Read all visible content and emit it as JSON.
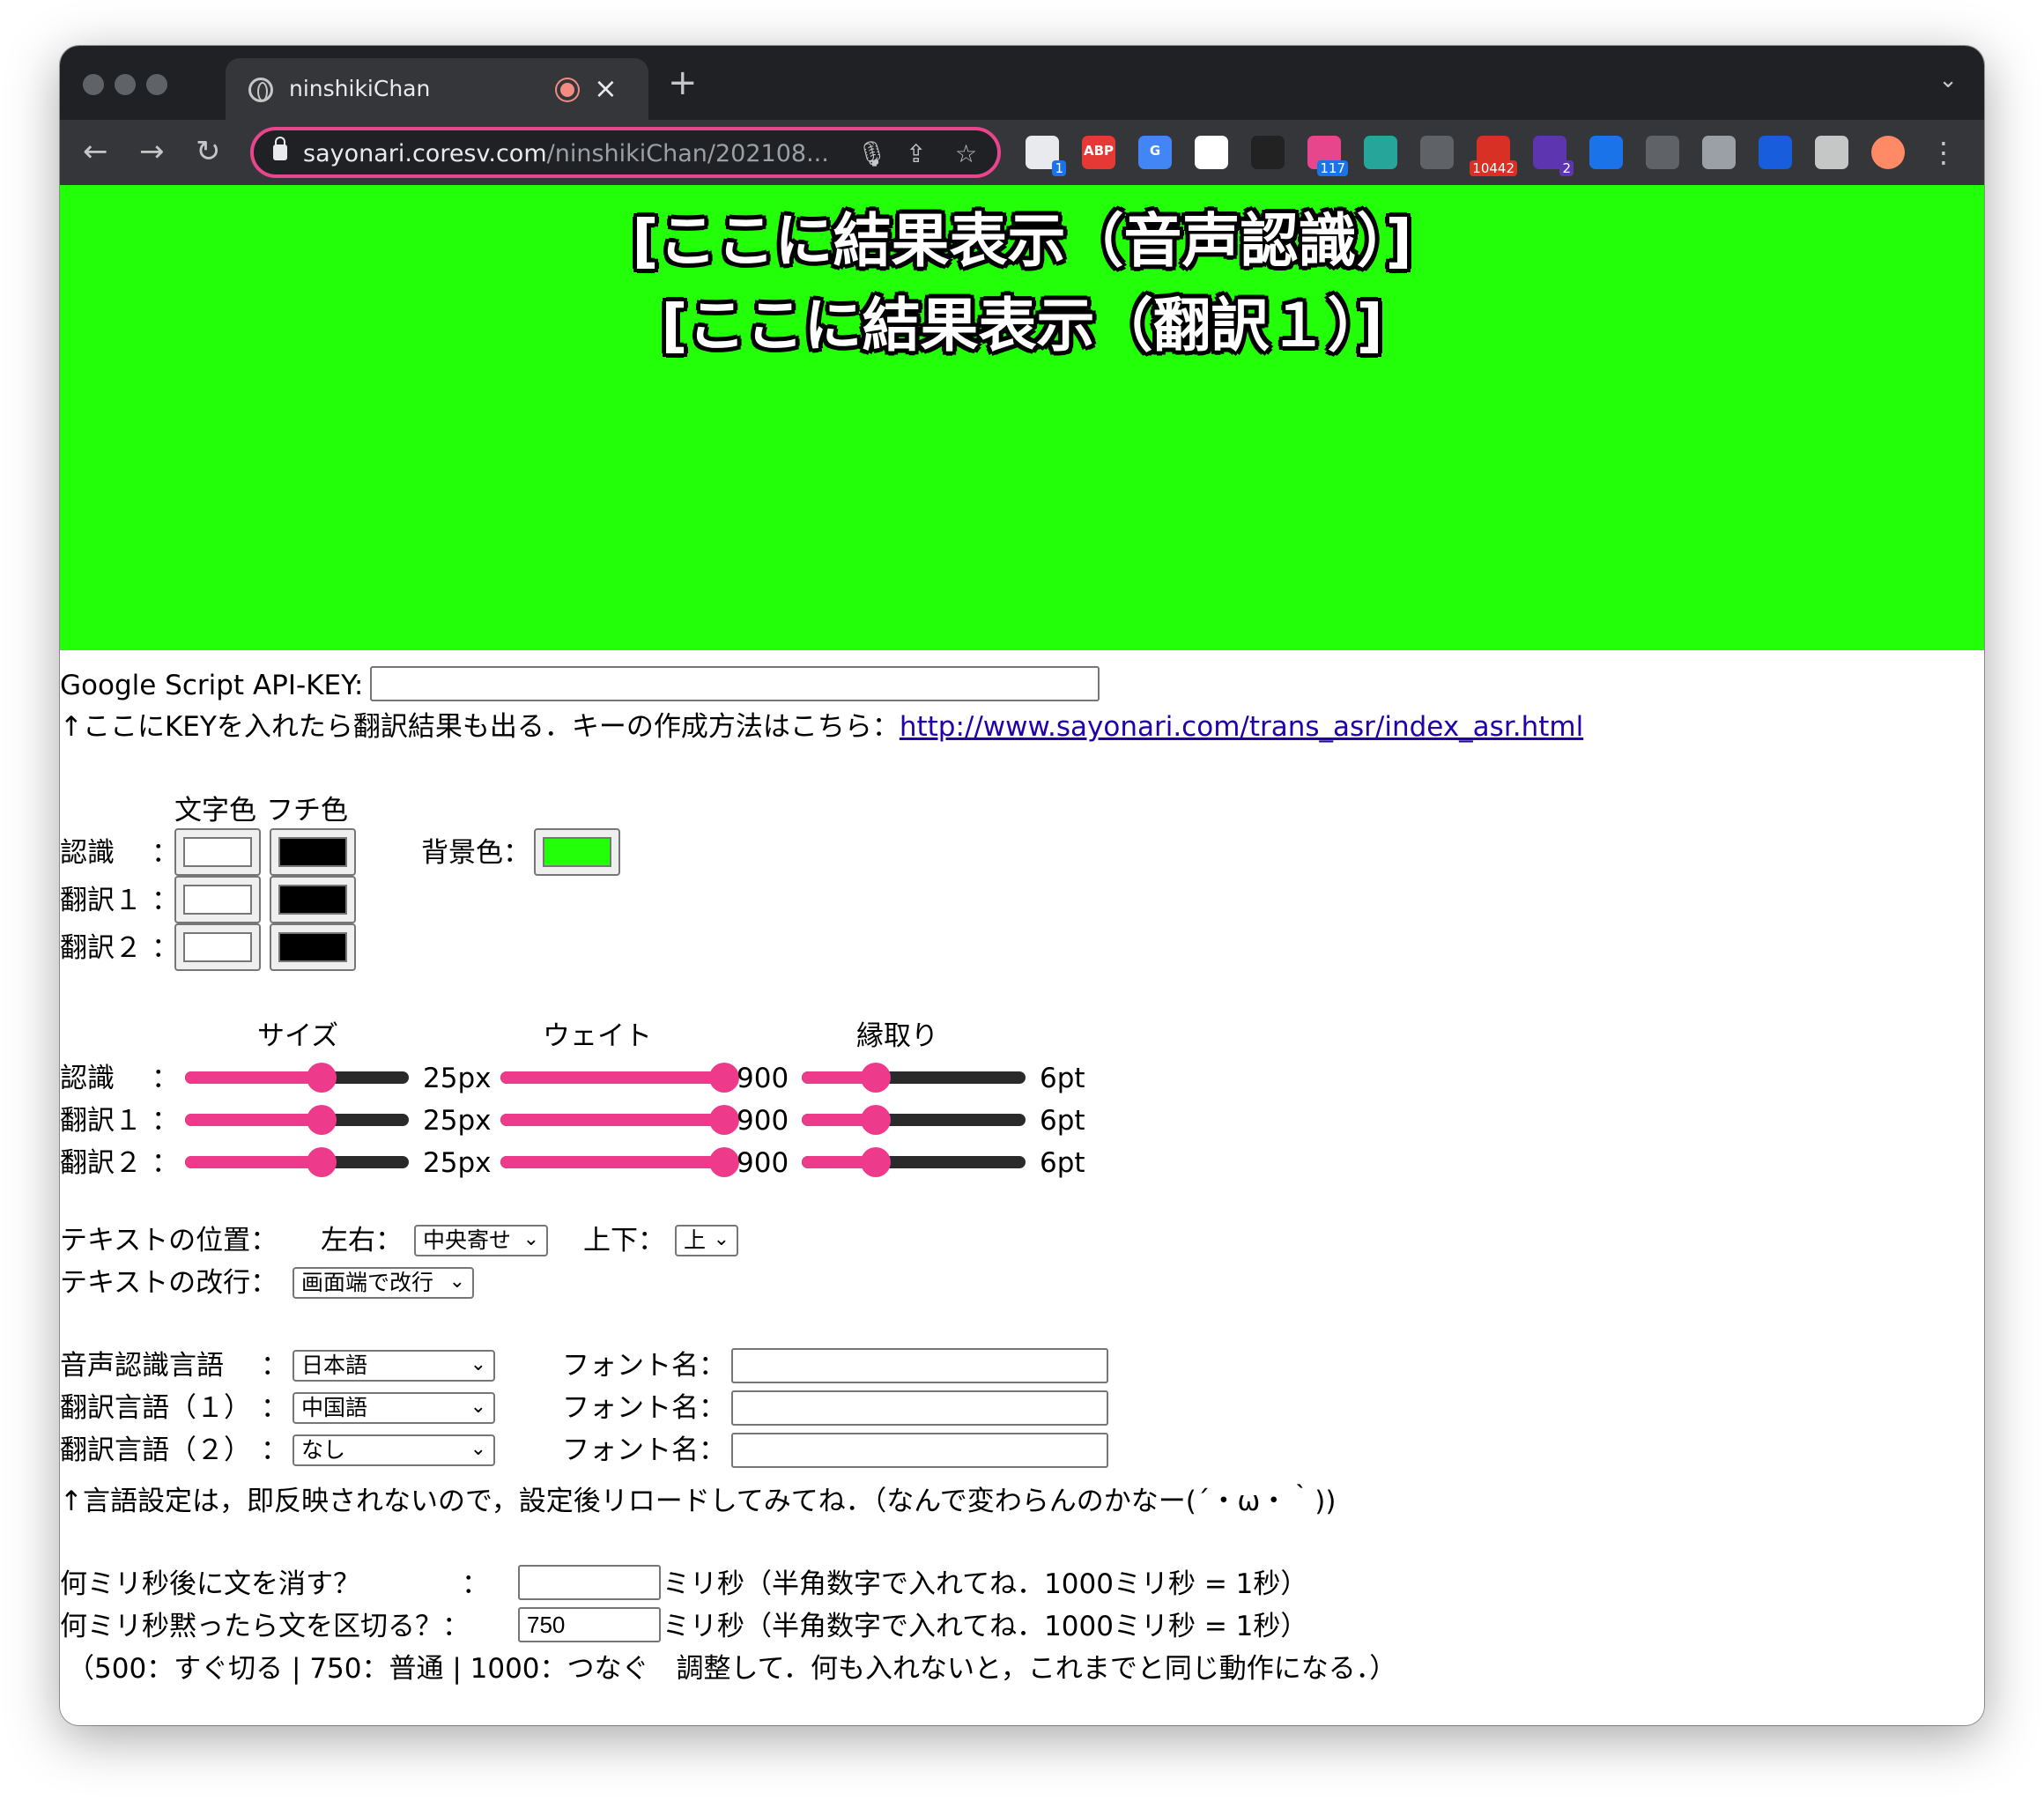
{
  "browser": {
    "tab_title": "ninshikiChan",
    "tab_close": "×",
    "new_tab": "+",
    "url_host": "sayonari.coresv.com",
    "url_path": "/ninshikiChan/202108...",
    "extensions": [
      {
        "name": "s",
        "badge": "1",
        "color": "#e8eaed",
        "badge_color": "#1a73e8"
      },
      {
        "name": "abp",
        "label": "ABP",
        "color": "#e53935"
      },
      {
        "name": "google-translate",
        "label": "G",
        "color": "#4285f4"
      },
      {
        "name": "japan-flag",
        "color": "#ffffff"
      },
      {
        "name": "glasses",
        "color": "#222222"
      },
      {
        "name": "cat",
        "badge": "117",
        "color": "#e8468c",
        "badge_color": "#1a73e8"
      },
      {
        "name": "bird",
        "color": "#26a69a"
      },
      {
        "name": "blocks",
        "color": "#5f6368"
      },
      {
        "name": "gmail",
        "badge": "10442",
        "color": "#d93025",
        "badge_color": "#d93025"
      },
      {
        "name": "cube",
        "badge": "2",
        "color": "#5e35b1",
        "badge_color": "#5e35b1"
      },
      {
        "name": "edge-swirl",
        "color": "#1a73e8"
      },
      {
        "name": "move",
        "color": "#5f6368"
      },
      {
        "name": "calendar",
        "color": "#9aa0a6"
      },
      {
        "name": "shield",
        "color": "#175ddc"
      },
      {
        "name": "puzzle",
        "color": "#c4c7c5"
      },
      {
        "name": "avatar",
        "color": "#ff8a65"
      }
    ]
  },
  "display": {
    "recognition_text": "[ここに結果表示（音声認識）]",
    "translation1_text": "[ここに結果表示（翻訳１）]",
    "background_color": "#22ff08"
  },
  "api": {
    "label": "Google Script API-KEY:",
    "value": "",
    "note": "↑ここにKEYを入れたら翻訳結果も出る．キーの作成方法はこちら：",
    "link_text": "http://www.sayonari.com/trans_asr/index_asr.html"
  },
  "colors": {
    "header_text": "文字色",
    "header_edge": "フチ色",
    "bg_label": "背景色：",
    "bg_value": "#22ff08",
    "rows": [
      {
        "label": "認識",
        "colon": "：",
        "text": "#ffffff",
        "edge": "#000000"
      },
      {
        "label": "翻訳１",
        "colon": "：",
        "text": "#ffffff",
        "edge": "#000000"
      },
      {
        "label": "翻訳２",
        "colon": "：",
        "text": "#ffffff",
        "edge": "#000000"
      }
    ]
  },
  "sliders": {
    "header_size": "サイズ",
    "header_weight": "ウェイト",
    "header_stroke": "縁取り",
    "rows": [
      {
        "label": "認識",
        "colon": "：",
        "size": "25px",
        "size_frac": 0.61,
        "weight": "900",
        "weight_frac": 1.0,
        "stroke": "6pt",
        "stroke_frac": 0.33
      },
      {
        "label": "翻訳１",
        "colon": "：",
        "size": "25px",
        "size_frac": 0.61,
        "weight": "900",
        "weight_frac": 1.0,
        "stroke": "6pt",
        "stroke_frac": 0.33
      },
      {
        "label": "翻訳２",
        "colon": "：",
        "size": "25px",
        "size_frac": 0.61,
        "weight": "900",
        "weight_frac": 1.0,
        "stroke": "6pt",
        "stroke_frac": 0.33
      }
    ]
  },
  "position": {
    "label": "テキストの位置：",
    "h_label": "左右：",
    "h_value": "中央寄せ",
    "v_label": "上下：",
    "v_value": "上",
    "wrap_label": "テキストの改行：",
    "wrap_value": "画面端で改行"
  },
  "languages": {
    "colon": "：",
    "font_label": "フォント名：",
    "rows": [
      {
        "label": "音声認識言語",
        "value": "日本語",
        "font": ""
      },
      {
        "label": "翻訳言語（１）",
        "value": "中国語",
        "font": ""
      },
      {
        "label": "翻訳言語（２）",
        "value": "なし",
        "font": ""
      }
    ],
    "note": "↑言語設定は，即反映されないので，設定後リロードしてみてね．（なんで変わらんのかなー(´・ω・｀))"
  },
  "timing": {
    "colon": "：",
    "clear_label": "何ミリ秒後に文を消す？",
    "clear_value": "",
    "clear_suffix": "ミリ秒（半角数字で入れてね．1000ミリ秒 = 1秒）",
    "split_label": "何ミリ秒黙ったら文を区切る？：",
    "split_value": "750",
    "split_suffix": "ミリ秒（半角数字で入れてね．1000ミリ秒 = 1秒）",
    "note": "（500：すぐ切る | 750：普通 | 1000：つなぐ　調整して．何も入れないと，これまでと同じ動作になる．）"
  }
}
